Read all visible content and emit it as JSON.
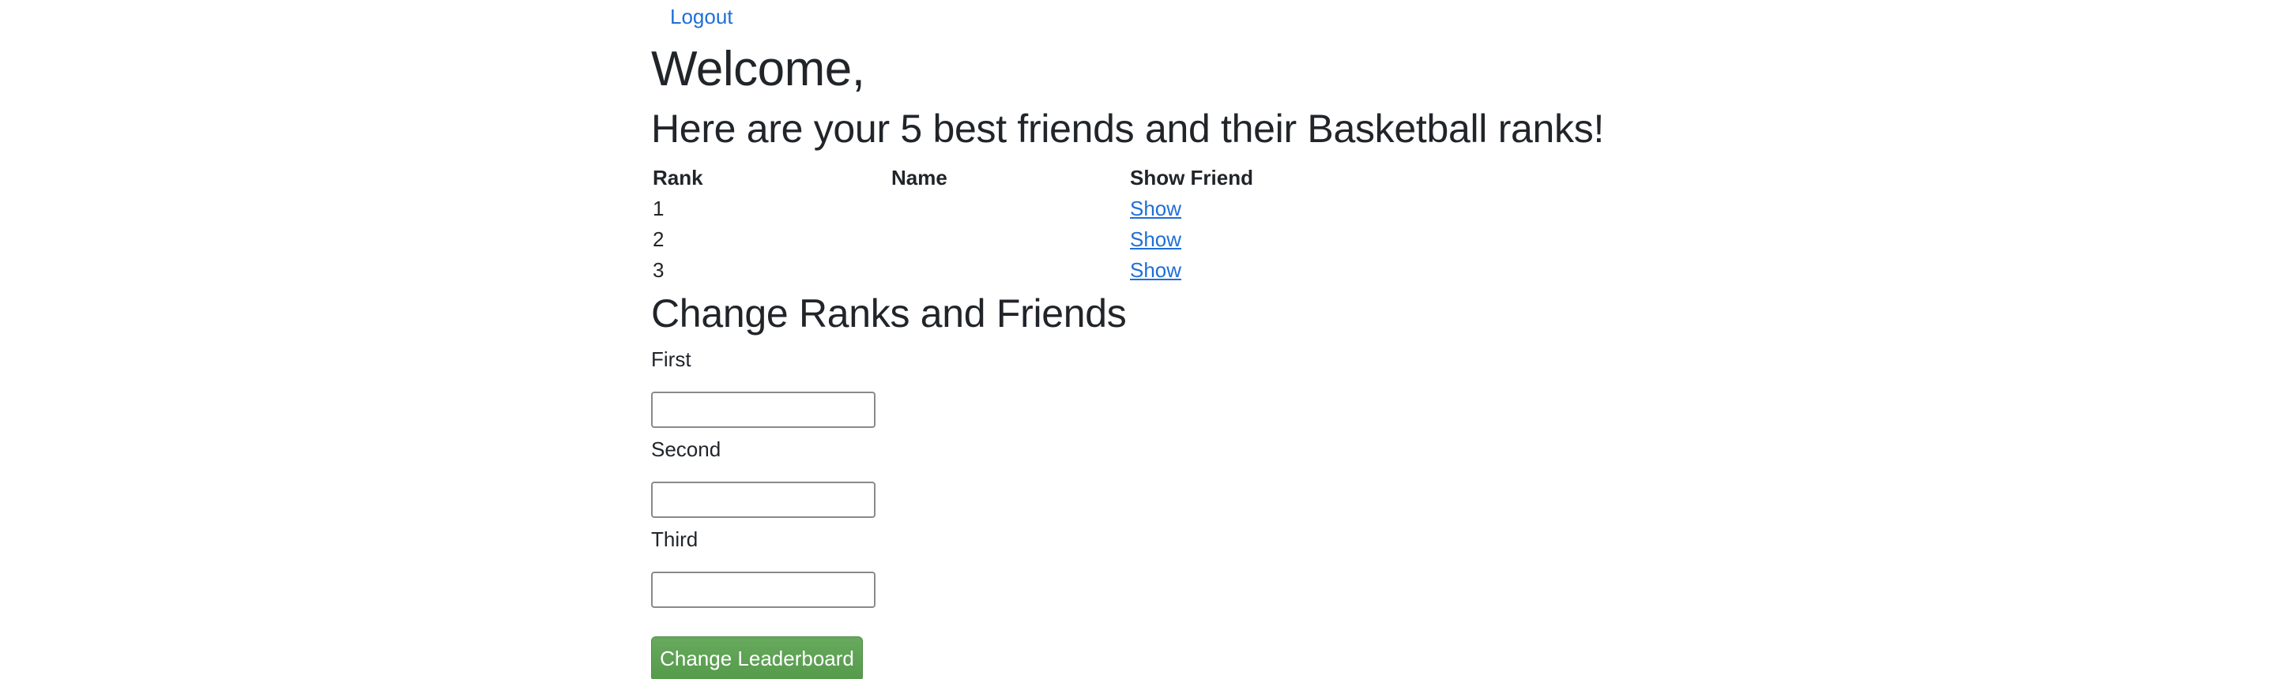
{
  "nav": {
    "logout_label": "Logout"
  },
  "header": {
    "welcome": "Welcome,",
    "subtitle": "Here are your 5 best friends and their Basketball ranks!"
  },
  "table": {
    "headers": {
      "rank": "Rank",
      "name": "Name",
      "show": "Show Friend"
    },
    "rows": [
      {
        "rank": "1",
        "name": "",
        "show": "Show"
      },
      {
        "rank": "2",
        "name": "",
        "show": "Show"
      },
      {
        "rank": "3",
        "name": "",
        "show": "Show"
      }
    ]
  },
  "form": {
    "title": "Change Ranks and Friends",
    "fields": [
      {
        "label": "First",
        "value": ""
      },
      {
        "label": "Second",
        "value": ""
      },
      {
        "label": "Third",
        "value": ""
      }
    ],
    "submit_label": "Change Leaderboard"
  },
  "colors": {
    "link": "#1f6fd6",
    "button": "#5ca152",
    "text": "#212529"
  }
}
